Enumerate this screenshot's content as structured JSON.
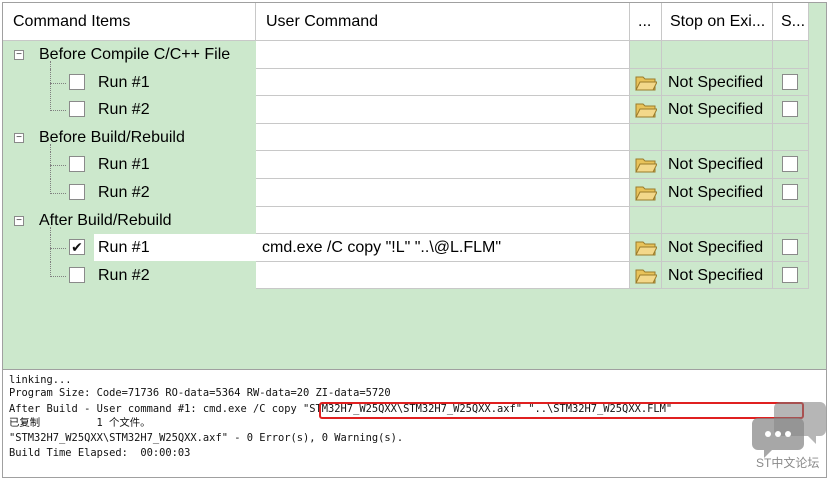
{
  "columns": {
    "items": "Command Items",
    "user": "User Command",
    "dots": "...",
    "stop": "Stop on Exi...",
    "s": "S..."
  },
  "groups": [
    {
      "label": "Before Compile C/C++ File",
      "runs": [
        {
          "label": "Run #1",
          "checked": false,
          "command": "",
          "stop": "Not Specified",
          "checkmark": ""
        },
        {
          "label": "Run #2",
          "checked": false,
          "command": "",
          "stop": "Not Specified",
          "checkmark": ""
        }
      ]
    },
    {
      "label": "Before Build/Rebuild",
      "runs": [
        {
          "label": "Run #1",
          "checked": false,
          "command": "",
          "stop": "Not Specified",
          "checkmark": ""
        },
        {
          "label": "Run #2",
          "checked": false,
          "command": "",
          "stop": "Not Specified",
          "checkmark": ""
        }
      ]
    },
    {
      "label": "After Build/Rebuild",
      "runs": [
        {
          "label": "Run #1",
          "checked": true,
          "command": "cmd.exe /C copy \"!L\" \"..\\@L.FLM\"",
          "stop": "Not Specified",
          "checkmark": "✔"
        },
        {
          "label": "Run #2",
          "checked": false,
          "command": "",
          "stop": "Not Specified",
          "checkmark": ""
        }
      ]
    }
  ],
  "output": [
    "linking...",
    "Program Size: Code=71736 RO-data=5364 RW-data=20 ZI-data=5720",
    "After Build - User command #1: cmd.exe /C copy \"STM32H7_W25QXX\\STM32H7_W25QXX.axf\" \"..\\STM32H7_W25QXX.FLM\"",
    "已复制         1 个文件。",
    "\"STM32H7_W25QXX\\STM32H7_W25QXX.axf\" - 0 Error(s), 0 Warning(s).",
    "Build Time Elapsed:  00:00:03"
  ],
  "watermark": "ST中文论坛",
  "expander_symbol": "−",
  "colors": {
    "grid_bg": "#cce8cc",
    "highlight": "#e02020",
    "folder": "#e8c35a"
  }
}
